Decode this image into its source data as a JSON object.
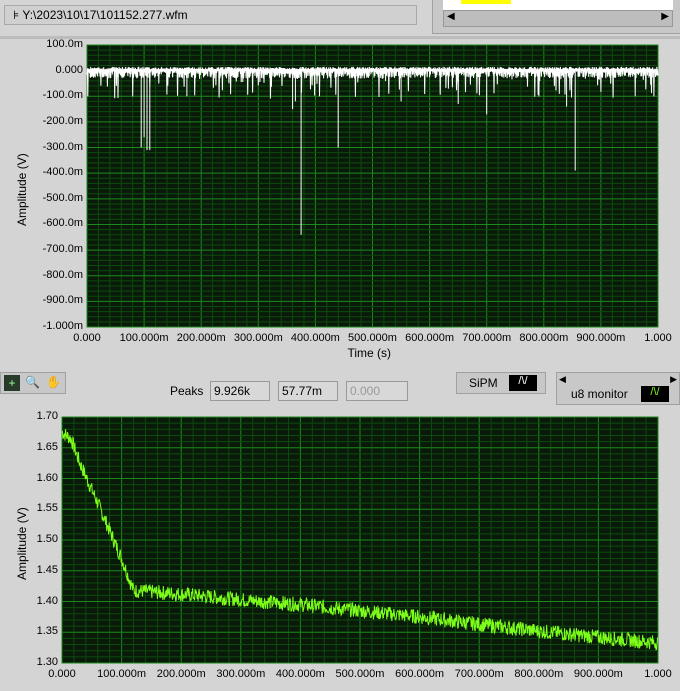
{
  "file_path": "Y:\\2023\\10\\17\\101152.277.wfm",
  "toolbar": {
    "peaks_label": "Peaks",
    "peaks_values": [
      "9.926k",
      "57.77m",
      "0.000"
    ],
    "sipm_label": "SiPM",
    "u8_label": "u8 monitor"
  },
  "chart_data": [
    {
      "type": "line",
      "title": "",
      "xlabel": "Time (s)",
      "ylabel": "Amplitude (V)",
      "xlim": [
        0,
        1
      ],
      "ylim": [
        -1,
        0.1
      ],
      "xticks": [
        "0.000",
        "100.000m",
        "200.000m",
        "300.000m",
        "400.000m",
        "500.000m",
        "600.000m",
        "700.000m",
        "800.000m",
        "900.000m",
        "1.000"
      ],
      "yticks": [
        "100.0m",
        "0.000",
        "-100.0m",
        "-200.0m",
        "-300.0m",
        "-400.0m",
        "-500.0m",
        "-600.0m",
        "-700.0m",
        "-800.0m",
        "-900.0m",
        "-1.000m"
      ],
      "series": [
        {
          "name": "SiPM",
          "color": "#ffffff",
          "baseline": -0.03,
          "noise_min": -0.11,
          "spikes": [
            [
              0.095,
              -0.3
            ],
            [
              0.1,
              -0.26
            ],
            [
              0.105,
              -0.31
            ],
            [
              0.11,
              -0.31
            ],
            [
              0.175,
              -0.1
            ],
            [
              0.36,
              -0.15
            ],
            [
              0.375,
              -0.64
            ],
            [
              0.365,
              -0.12
            ],
            [
              0.44,
              -0.3
            ],
            [
              0.55,
              -0.12
            ],
            [
              0.65,
              -0.13
            ],
            [
              0.7,
              -0.17
            ],
            [
              0.855,
              -0.39
            ],
            [
              0.84,
              -0.14
            ],
            [
              0.96,
              -0.1
            ]
          ]
        }
      ]
    },
    {
      "type": "line",
      "title": "",
      "xlabel": "",
      "ylabel": "Amplitude (V)",
      "xlim": [
        0,
        1
      ],
      "ylim": [
        1.3,
        1.7
      ],
      "xticks": [
        "0.000",
        "100.000m",
        "200.000m",
        "300.000m",
        "400.000m",
        "500.000m",
        "600.000m",
        "700.000m",
        "800.000m",
        "900.000m",
        "1.000"
      ],
      "yticks": [
        "1.70",
        "1.65",
        "1.60",
        "1.55",
        "1.50",
        "1.45",
        "1.40",
        "1.35",
        "1.30"
      ],
      "series": [
        {
          "name": "u8 monitor",
          "color": "#7dff1a",
          "noise": 0.012,
          "points": [
            [
              0,
              1.675
            ],
            [
              0.015,
              1.665
            ],
            [
              0.03,
              1.625
            ],
            [
              0.06,
              1.56
            ],
            [
              0.1,
              1.47
            ],
            [
              0.12,
              1.418
            ],
            [
              0.2,
              1.412
            ],
            [
              0.3,
              1.403
            ],
            [
              0.4,
              1.395
            ],
            [
              0.5,
              1.385
            ],
            [
              0.6,
              1.375
            ],
            [
              0.7,
              1.363
            ],
            [
              0.8,
              1.352
            ],
            [
              0.9,
              1.342
            ],
            [
              1.0,
              1.333
            ]
          ]
        }
      ]
    }
  ]
}
